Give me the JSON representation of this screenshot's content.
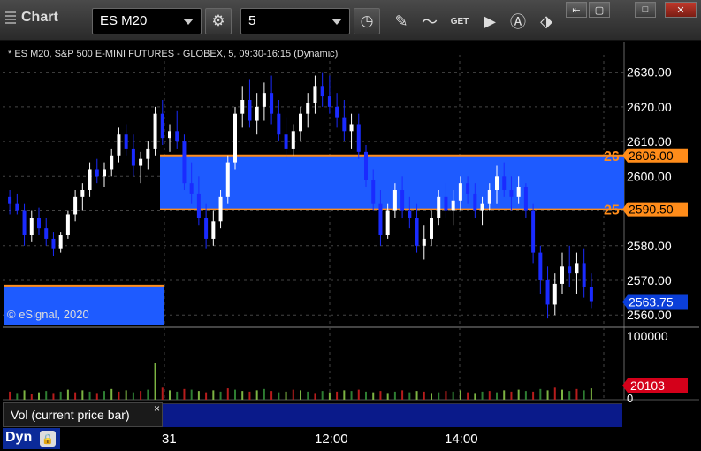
{
  "window": {
    "title": "Chart",
    "symbol": "ES M20",
    "interval": "5",
    "win_buttons": [
      "⇤",
      "▢",
      "□",
      "✕"
    ]
  },
  "chart": {
    "legend": "* ES M20, S&P 500 E-MINI FUTURES - GLOBEX, 5, 09:30-16:15 (Dynamic)",
    "copyright": "© eSignal, 2020",
    "colors": {
      "up": "#ffffff",
      "down": "#1a2bff",
      "zone": "#1e5bff",
      "level": "#ff8c1a",
      "last": "#0b3fd9",
      "vol_last": "#d4001a"
    },
    "zone_labels": {
      "upper_tag": "26",
      "lower_tag": "25"
    }
  },
  "axis": {
    "price_ticks": [
      "2630.00",
      "2620.00",
      "2610.00",
      "2600.00",
      "2580.00",
      "2570.00",
      "2560.00"
    ],
    "upper_level": "2606.00",
    "lower_level": "2590.50",
    "last_price": "2563.75",
    "vol_ticks": [
      "100000",
      "0"
    ],
    "vol_last": "20103",
    "time_labels": [
      "31",
      "12:00",
      "14:00"
    ]
  },
  "bottom": {
    "vol_label": "Vol (current price bar)",
    "vol_close": "×",
    "mode": "Dyn"
  },
  "chart_data": {
    "type": "candlestick",
    "ylim": [
      2557,
      2635
    ],
    "zone": {
      "high": 2606.0,
      "low": 2590.5
    },
    "prior_zone": {
      "high": 2568.5,
      "low": 2555
    },
    "candles": [
      [
        2594,
        2596,
        2589,
        2592
      ],
      [
        2592,
        2595,
        2589,
        2590
      ],
      [
        2590,
        2592,
        2580,
        2583
      ],
      [
        2583,
        2590,
        2581,
        2588
      ],
      [
        2588,
        2591,
        2583,
        2585
      ],
      [
        2585,
        2588,
        2580,
        2582
      ],
      [
        2582,
        2584,
        2577,
        2579
      ],
      [
        2579,
        2584,
        2578,
        2583
      ],
      [
        2583,
        2590,
        2582,
        2589
      ],
      [
        2589,
        2596,
        2587,
        2594
      ],
      [
        2594,
        2598,
        2590,
        2596
      ],
      [
        2596,
        2604,
        2594,
        2602
      ],
      [
        2602,
        2605,
        2598,
        2600
      ],
      [
        2600,
        2604,
        2597,
        2602
      ],
      [
        2602,
        2608,
        2600,
        2606
      ],
      [
        2606,
        2614,
        2604,
        2612
      ],
      [
        2612,
        2615,
        2606,
        2608
      ],
      [
        2608,
        2612,
        2600,
        2603
      ],
      [
        2603,
        2607,
        2598,
        2605
      ],
      [
        2605,
        2610,
        2602,
        2608
      ],
      [
        2608,
        2620,
        2606,
        2618
      ],
      [
        2618,
        2622,
        2609,
        2611
      ],
      [
        2611,
        2615,
        2607,
        2613
      ],
      [
        2613,
        2619,
        2608,
        2610
      ],
      [
        2610,
        2612,
        2596,
        2598
      ],
      [
        2598,
        2604,
        2592,
        2595
      ],
      [
        2595,
        2600,
        2586,
        2588
      ],
      [
        2588,
        2592,
        2579,
        2582
      ],
      [
        2582,
        2590,
        2580,
        2587
      ],
      [
        2587,
        2596,
        2585,
        2594
      ],
      [
        2594,
        2606,
        2592,
        2604
      ],
      [
        2604,
        2620,
        2602,
        2618
      ],
      [
        2618,
        2626,
        2614,
        2622
      ],
      [
        2622,
        2628,
        2614,
        2616
      ],
      [
        2616,
        2624,
        2612,
        2620
      ],
      [
        2620,
        2627,
        2616,
        2624
      ],
      [
        2624,
        2629,
        2615,
        2618
      ],
      [
        2618,
        2622,
        2610,
        2612
      ],
      [
        2612,
        2617,
        2605,
        2608
      ],
      [
        2608,
        2615,
        2606,
        2613
      ],
      [
        2613,
        2620,
        2610,
        2618
      ],
      [
        2618,
        2624,
        2614,
        2621
      ],
      [
        2621,
        2629,
        2618,
        2626
      ],
      [
        2626,
        2630,
        2620,
        2623
      ],
      [
        2623,
        2629,
        2618,
        2620
      ],
      [
        2620,
        2624,
        2614,
        2617
      ],
      [
        2617,
        2622,
        2610,
        2613
      ],
      [
        2613,
        2618,
        2608,
        2615
      ],
      [
        2615,
        2618,
        2605,
        2607
      ],
      [
        2607,
        2609,
        2597,
        2599
      ],
      [
        2599,
        2602,
        2590,
        2592
      ],
      [
        2592,
        2596,
        2580,
        2583
      ],
      [
        2583,
        2592,
        2582,
        2590
      ],
      [
        2590,
        2598,
        2588,
        2596
      ],
      [
        2596,
        2600,
        2588,
        2590
      ],
      [
        2590,
        2594,
        2585,
        2588
      ],
      [
        2588,
        2592,
        2578,
        2580
      ],
      [
        2580,
        2586,
        2576,
        2582
      ],
      [
        2582,
        2590,
        2580,
        2588
      ],
      [
        2588,
        2596,
        2586,
        2594
      ],
      [
        2594,
        2598,
        2588,
        2590
      ],
      [
        2590,
        2596,
        2586,
        2593
      ],
      [
        2593,
        2600,
        2590,
        2598
      ],
      [
        2598,
        2600,
        2592,
        2595
      ],
      [
        2595,
        2598,
        2588,
        2590
      ],
      [
        2590,
        2594,
        2586,
        2592
      ],
      [
        2592,
        2598,
        2590,
        2596
      ],
      [
        2596,
        2603,
        2592,
        2600
      ],
      [
        2600,
        2604,
        2594,
        2596
      ],
      [
        2596,
        2600,
        2590,
        2594
      ],
      [
        2594,
        2600,
        2592,
        2597
      ],
      [
        2597,
        2598,
        2588,
        2590
      ],
      [
        2590,
        2592,
        2575,
        2578
      ],
      [
        2578,
        2580,
        2566,
        2570
      ],
      [
        2570,
        2574,
        2559,
        2563
      ],
      [
        2563,
        2572,
        2560,
        2569
      ],
      [
        2569,
        2578,
        2566,
        2574
      ],
      [
        2574,
        2580,
        2568,
        2572
      ],
      [
        2572,
        2578,
        2566,
        2575
      ],
      [
        2575,
        2579,
        2565,
        2568
      ],
      [
        2568,
        2572,
        2562,
        2564
      ]
    ],
    "volume": [
      12,
      10,
      14,
      9,
      11,
      13,
      10,
      12,
      15,
      11,
      14,
      12,
      10,
      13,
      16,
      12,
      14,
      11,
      13,
      15,
      55,
      18,
      14,
      12,
      16,
      15,
      13,
      11,
      14,
      12,
      17,
      15,
      13,
      12,
      14,
      16,
      13,
      11,
      12,
      15,
      14,
      12,
      10,
      13,
      11,
      12,
      14,
      13,
      15,
      12,
      11,
      13,
      10,
      12,
      14,
      11,
      13,
      12,
      10,
      11,
      13,
      12,
      14,
      11,
      10,
      12,
      13,
      11,
      14,
      12,
      15,
      13,
      12,
      16,
      14,
      18,
      15,
      13,
      16,
      14,
      17
    ]
  }
}
